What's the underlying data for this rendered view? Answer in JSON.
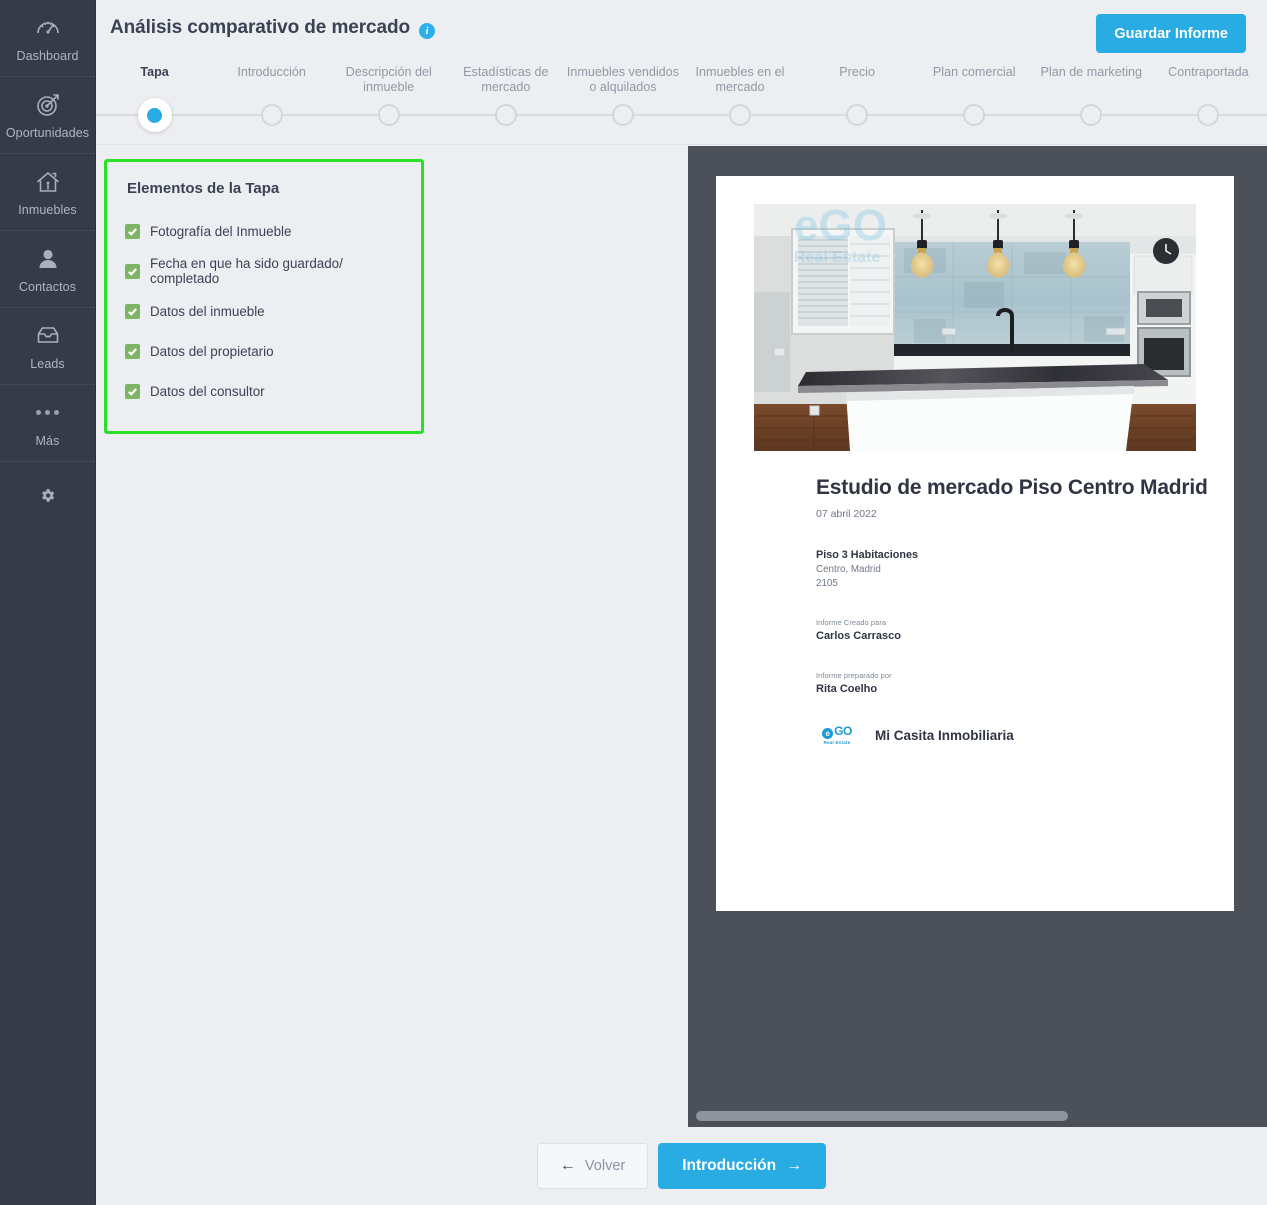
{
  "sidebar": {
    "items": [
      {
        "label": "Dashboard",
        "icon": "dashboard-gauge-icon"
      },
      {
        "label": "Oportunidades",
        "icon": "target-dart-icon"
      },
      {
        "label": "Inmuebles",
        "icon": "house-icon"
      },
      {
        "label": "Contactos",
        "icon": "person-icon"
      },
      {
        "label": "Leads",
        "icon": "inbox-tray-icon"
      },
      {
        "label": "Más",
        "icon": "ellipsis-icon"
      }
    ],
    "settings_icon": "gear-icon"
  },
  "header": {
    "title": "Análisis comparativo de mercado",
    "info_icon": "info-icon",
    "info_glyph": "i",
    "save_label": "Guardar Informe"
  },
  "stepper": {
    "active_index": 0,
    "steps": [
      {
        "label": "Tapa"
      },
      {
        "label": "Introducción"
      },
      {
        "label": "Descripción del inmueble"
      },
      {
        "label": "Estadísticas de mercado"
      },
      {
        "label": "Inmuebles vendidos o alquilados"
      },
      {
        "label": "Inmuebles en el mercado"
      },
      {
        "label": "Precio"
      },
      {
        "label": "Plan comercial"
      },
      {
        "label": "Plan de marketing"
      },
      {
        "label": "Contraportada"
      }
    ]
  },
  "elements_card": {
    "title": "Elementos de la Tapa",
    "highlight_color": "#28e028",
    "checkbox_color": "#7fb466",
    "items": [
      {
        "label": "Fotografía del Inmueble",
        "checked": true
      },
      {
        "label": "Fecha en que ha sido guardado/ completado",
        "checked": true
      },
      {
        "label": "Datos del inmueble",
        "checked": true
      },
      {
        "label": "Datos del propietario",
        "checked": true
      },
      {
        "label": "Datos del consultor",
        "checked": true
      }
    ]
  },
  "preview": {
    "photo_alt": "kitchen-photo",
    "watermark": "eGO Real Estate",
    "doc_title": "Estudio de mercado Piso Centro Madrid",
    "doc_date": "07 abril 2022",
    "property_title": "Piso 3 Habitaciones",
    "property_location": "Centro, Madrid",
    "property_ref": "2105",
    "created_for_caption": "Informe Creado para",
    "created_for_name": "Carlos Carrasco",
    "prepared_by_caption": "Informe preparado por",
    "prepared_by_name": "Rita Coelho",
    "agency_logo_top": "GO",
    "agency_logo_mark": "e",
    "agency_logo_bottom": "Real Estate",
    "agency_name": "Mi Casita Inmobiliaria"
  },
  "footer": {
    "back_label": "Volver",
    "back_arrow": "←",
    "next_label": "Introducción",
    "next_arrow": "→"
  },
  "colors": {
    "accent": "#29abe4",
    "sidebar_bg": "#353b48",
    "preview_bg": "#4b5059",
    "page_bg": "#eceef1",
    "highlight": "#28e028"
  }
}
